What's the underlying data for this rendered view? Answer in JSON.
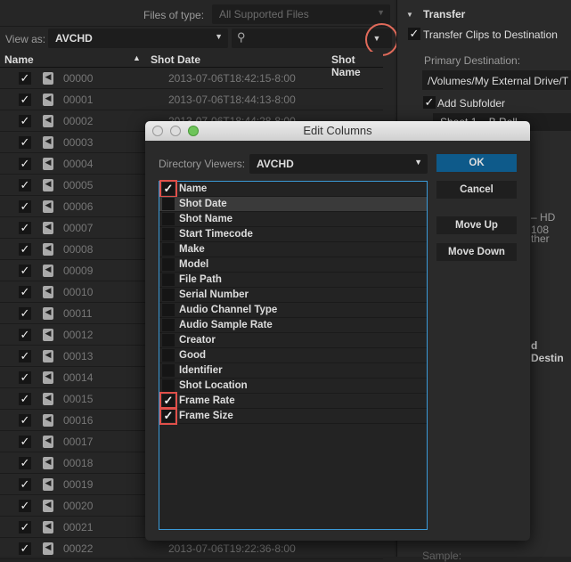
{
  "browser": {
    "files_of_type_label": "Files of type:",
    "files_of_type_value": "All Supported Files",
    "view_as_label": "View as:",
    "view_as_value": "AVCHD",
    "columns": {
      "name": "Name",
      "shot_date": "Shot Date",
      "shot_name": "Shot Name"
    },
    "rows": [
      {
        "name": "00000",
        "date": "2013-07-06T18:42:15-8:00"
      },
      {
        "name": "00001",
        "date": "2013-07-06T18:44:13-8:00"
      },
      {
        "name": "00002",
        "date": "2013-07-06T18:44:28-8:00"
      },
      {
        "name": "00003",
        "date": ""
      },
      {
        "name": "00004",
        "date": ""
      },
      {
        "name": "00005",
        "date": ""
      },
      {
        "name": "00006",
        "date": ""
      },
      {
        "name": "00007",
        "date": ""
      },
      {
        "name": "00008",
        "date": ""
      },
      {
        "name": "00009",
        "date": ""
      },
      {
        "name": "00010",
        "date": ""
      },
      {
        "name": "00011",
        "date": ""
      },
      {
        "name": "00012",
        "date": ""
      },
      {
        "name": "00013",
        "date": ""
      },
      {
        "name": "00014",
        "date": ""
      },
      {
        "name": "00015",
        "date": ""
      },
      {
        "name": "00016",
        "date": ""
      },
      {
        "name": "00017",
        "date": ""
      },
      {
        "name": "00018",
        "date": ""
      },
      {
        "name": "00019",
        "date": ""
      },
      {
        "name": "00020",
        "date": ""
      },
      {
        "name": "00021",
        "date": ""
      },
      {
        "name": "00022",
        "date": "2013-07-06T19:22:36-8:00"
      }
    ]
  },
  "transfer": {
    "title": "Transfer",
    "transfer_clips": "Transfer Clips to Destination",
    "primary_destination_label": "Primary Destination:",
    "primary_destination_value": "/Volumes/My External Drive/T",
    "add_subfolder": "Add Subfolder",
    "subfolder_value": "Shoot 1 – B Roll",
    "partial_1": "– HD 108",
    "partial_2": "ther",
    "partial_3": "d Destin",
    "sample_label": "Sample:"
  },
  "dialog": {
    "title": "Edit Columns",
    "directory_viewers_label": "Directory Viewers:",
    "directory_viewers_value": "AVCHD",
    "ok": "OK",
    "cancel": "Cancel",
    "move_up": "Move Up",
    "move_down": "Move Down",
    "items": [
      {
        "label": "Name",
        "checked": true
      },
      {
        "label": "Shot Date",
        "checked": false
      },
      {
        "label": "Shot Name",
        "checked": false
      },
      {
        "label": "Start Timecode",
        "checked": false
      },
      {
        "label": "Make",
        "checked": false
      },
      {
        "label": "Model",
        "checked": false
      },
      {
        "label": "File Path",
        "checked": false
      },
      {
        "label": "Serial Number",
        "checked": false
      },
      {
        "label": "Audio Channel Type",
        "checked": false
      },
      {
        "label": "Audio Sample Rate",
        "checked": false
      },
      {
        "label": "Creator",
        "checked": false
      },
      {
        "label": "Good",
        "checked": false
      },
      {
        "label": "Identifier",
        "checked": false
      },
      {
        "label": "Shot Location",
        "checked": false
      },
      {
        "label": "Frame Rate",
        "checked": true
      },
      {
        "label": "Frame Size",
        "checked": true
      }
    ],
    "accent": "#0e5a8a",
    "highlight": "#e0504a"
  }
}
